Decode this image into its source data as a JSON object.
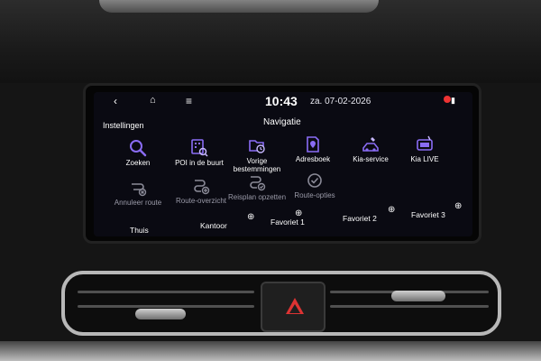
{
  "status": {
    "time": "10:43",
    "date": "za. 07-02-2026"
  },
  "header": {
    "left_label": "Instellingen",
    "title": "Navigatie"
  },
  "tiles_row1": [
    {
      "label": "Zoeken",
      "icon": "search-icon"
    },
    {
      "label": "POI in de buurt",
      "icon": "poi-icon"
    },
    {
      "label": "Vorige bestemmingen",
      "icon": "recent-destinations-icon"
    },
    {
      "label": "Adresboek",
      "icon": "address-book-icon"
    },
    {
      "label": "Kia-service",
      "icon": "service-icon"
    },
    {
      "label": "Kia LIVE",
      "icon": "live-icon"
    }
  ],
  "tiles_row2": [
    {
      "label": "Annuleer route",
      "icon": "cancel-route-icon"
    },
    {
      "label": "Route-overzicht",
      "icon": "route-overview-icon"
    },
    {
      "label": "Reisplan opzetten",
      "icon": "trip-plan-icon"
    },
    {
      "label": "Route-opties",
      "icon": "route-options-icon"
    }
  ],
  "favorites": [
    {
      "label": "Thuis"
    },
    {
      "label": "Kantoor"
    },
    {
      "label": "Favoriet 1"
    },
    {
      "label": "Favoriet 2"
    },
    {
      "label": "Favoriet 3"
    }
  ],
  "colors": {
    "accent": "#8a6cf5",
    "dim": "#9a9aa8",
    "screen_bg": "#0a0a12"
  }
}
